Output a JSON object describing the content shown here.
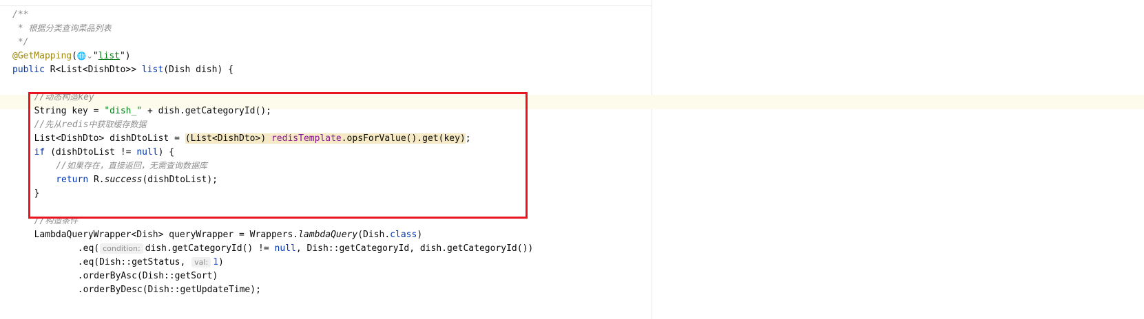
{
  "editor": {
    "lines": [
      {
        "indent": 0,
        "segments": [
          {
            "t": "/**",
            "c": "c"
          }
        ]
      },
      {
        "indent": 0,
        "segments": [
          {
            "t": " * ",
            "c": "c"
          },
          {
            "t": "根据分类查询菜品列表",
            "c": "c cn"
          }
        ]
      },
      {
        "indent": 0,
        "segments": [
          {
            "t": " */",
            "c": "c"
          }
        ]
      },
      {
        "indent": 0,
        "segments": [
          {
            "t": "@GetMapping",
            "c": "ann"
          },
          {
            "t": "("
          },
          {
            "t": "🌐⌄",
            "c": "globe"
          },
          {
            "t": "\""
          },
          {
            "t": "list",
            "c": "str ul"
          },
          {
            "t": "\")"
          }
        ]
      },
      {
        "indent": 0,
        "segments": [
          {
            "t": "public ",
            "c": "kw"
          },
          {
            "t": "R<List<DishDto>> "
          },
          {
            "t": "list",
            "c": "kw"
          },
          {
            "t": "(Dish dish) {"
          }
        ]
      },
      {
        "indent": 0,
        "segments": []
      },
      {
        "indent": 4,
        "segments": [
          {
            "t": "//",
            "c": "c"
          },
          {
            "t": "动态构造",
            "c": "c cn"
          },
          {
            "t": "key",
            "c": "c"
          }
        ]
      },
      {
        "indent": 4,
        "segments": [
          {
            "t": "String key = "
          },
          {
            "t": "\"dish_\"",
            "c": "str"
          },
          {
            "t": " + dish.getCategoryId();"
          }
        ]
      },
      {
        "indent": 4,
        "segments": [
          {
            "t": "//",
            "c": "c"
          },
          {
            "t": "先从",
            "c": "c cn"
          },
          {
            "t": "redis",
            "c": "c"
          },
          {
            "t": "中获取缓存数据",
            "c": "c cn"
          }
        ]
      },
      {
        "indent": 4,
        "segments": [
          {
            "t": "List<DishDto> dishDtoList = "
          },
          {
            "t": "(List<DishDto>) ",
            "c": "hl"
          },
          {
            "t": "redisTemplate",
            "c": "field hl"
          },
          {
            "t": ".opsForValue().get(key)",
            "c": "hl"
          },
          {
            "t": ";"
          }
        ]
      },
      {
        "indent": 4,
        "segments": [
          {
            "t": "if ",
            "c": "kw"
          },
          {
            "t": "(dishDtoList != "
          },
          {
            "t": "null",
            "c": "kw"
          },
          {
            "t": ") {"
          }
        ]
      },
      {
        "indent": 8,
        "segments": [
          {
            "t": "//",
            "c": "c"
          },
          {
            "t": "如果存在，直接返回，无需查询数据库",
            "c": "c cn"
          }
        ]
      },
      {
        "indent": 8,
        "segments": [
          {
            "t": "return ",
            "c": "kw"
          },
          {
            "t": "R."
          },
          {
            "t": "success",
            "c": "ital"
          },
          {
            "t": "(dishDtoList);"
          }
        ]
      },
      {
        "indent": 4,
        "segments": [
          {
            "t": "}"
          }
        ]
      },
      {
        "indent": 0,
        "segments": []
      },
      {
        "indent": 4,
        "segments": [
          {
            "t": "//",
            "c": "c"
          },
          {
            "t": "构造条件",
            "c": "c cn"
          }
        ]
      },
      {
        "indent": 4,
        "segments": [
          {
            "t": "LambdaQueryWrapper<Dish> queryWrapper = Wrappers."
          },
          {
            "t": "lambdaQuery",
            "c": "ital"
          },
          {
            "t": "(Dish."
          },
          {
            "t": "class",
            "c": "kw"
          },
          {
            "t": ")"
          }
        ]
      },
      {
        "indent": 12,
        "segments": [
          {
            "t": ".eq("
          },
          {
            "t": "condition:",
            "c": "hint"
          },
          {
            "t": "dish.getCategoryId() != "
          },
          {
            "t": "null",
            "c": "kw"
          },
          {
            "t": ", Dish::getCategoryId, dish.getCategoryId())"
          }
        ]
      },
      {
        "indent": 12,
        "segments": [
          {
            "t": ".eq(Dish::getStatus, "
          },
          {
            "t": "val:",
            "c": "hint"
          },
          {
            "t": "1",
            "c": "num"
          },
          {
            "t": ")"
          }
        ]
      },
      {
        "indent": 12,
        "segments": [
          {
            "t": ".orderByAsc(Dish::getSort)"
          }
        ]
      },
      {
        "indent": 12,
        "segments": [
          {
            "t": ".orderByDesc(Dish::getUpdateTime);"
          }
        ]
      }
    ]
  },
  "colors": {
    "highlight_box": "#e8141e",
    "keyword": "#0033b3",
    "string": "#067d17",
    "annotation": "#9e880d",
    "comment": "#8c8c8c",
    "field": "#871094"
  }
}
